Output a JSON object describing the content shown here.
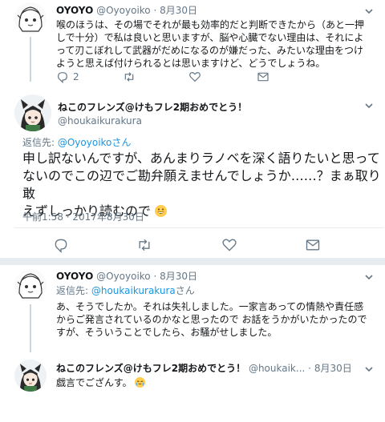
{
  "tweet1": {
    "name": "OYOYO",
    "handle": "@Oyoyoiko",
    "dot": "·",
    "time": "8月30日",
    "lines": [
      "喉のほうは、その場でそれが最も効率的だと判断できたから（あと一押",
      "しで十分）で私は良いと思いますが、脳や心臓でない理由は、それによ",
      "って刃こぼれして武器がだめになるのが嫌だった、みたいな理由をつけ",
      "ようと思えば付けられるとは思いますけど、どうでしょうね。"
    ],
    "reply_count": "2"
  },
  "tweet2": {
    "name": "ねこのフレンズ@けもフレ2期おめでとう！",
    "handle": "@houkaikurakura",
    "reply_to_label": "返信先: ",
    "reply_to_handle": "@Oyoyoikoさん",
    "lines": [
      "申し訳ないんですが、あんまりラノベを深く語りたいと思って",
      "ないのでこの辺でご勘弁願えませんでしょうか……？まぁ取り敢",
      "えずしっかり読むので"
    ],
    "timestamp": "午前1:58 · 2017年8月30日"
  },
  "tweet3": {
    "name": "OYOYO",
    "handle": "@Oyoyoiko",
    "dot": "·",
    "time": "8月30日",
    "reply_to_label": "返信先: ",
    "reply_to_handle": "@houkaikurakura",
    "reply_to_suffix": "さん",
    "lines": [
      "あ、そうでしたか。それは失礼しました。一家言あっての情熱や責任感",
      "からご発言されているのかなと思ったので お話をうかがいたかったので",
      "すが、そういうことでしたら、お騒がせしました。"
    ]
  },
  "tweet4": {
    "name": "ねこのフレンズ@けもフレ2期おめでとう！",
    "handle": "@houkaik...",
    "dot": "·",
    "time": "8月30日",
    "text": "戯言でござんす。"
  },
  "icons": [
    "reply-icon",
    "retweet-icon",
    "like-icon",
    "mail-icon",
    "caret-down-icon",
    "grin-emoji",
    "tears-emoji"
  ],
  "colors": {
    "link": "#1b95e0",
    "secondary": "#657786",
    "divider": "#e6ecf0",
    "thread": "#ccd6dd"
  }
}
